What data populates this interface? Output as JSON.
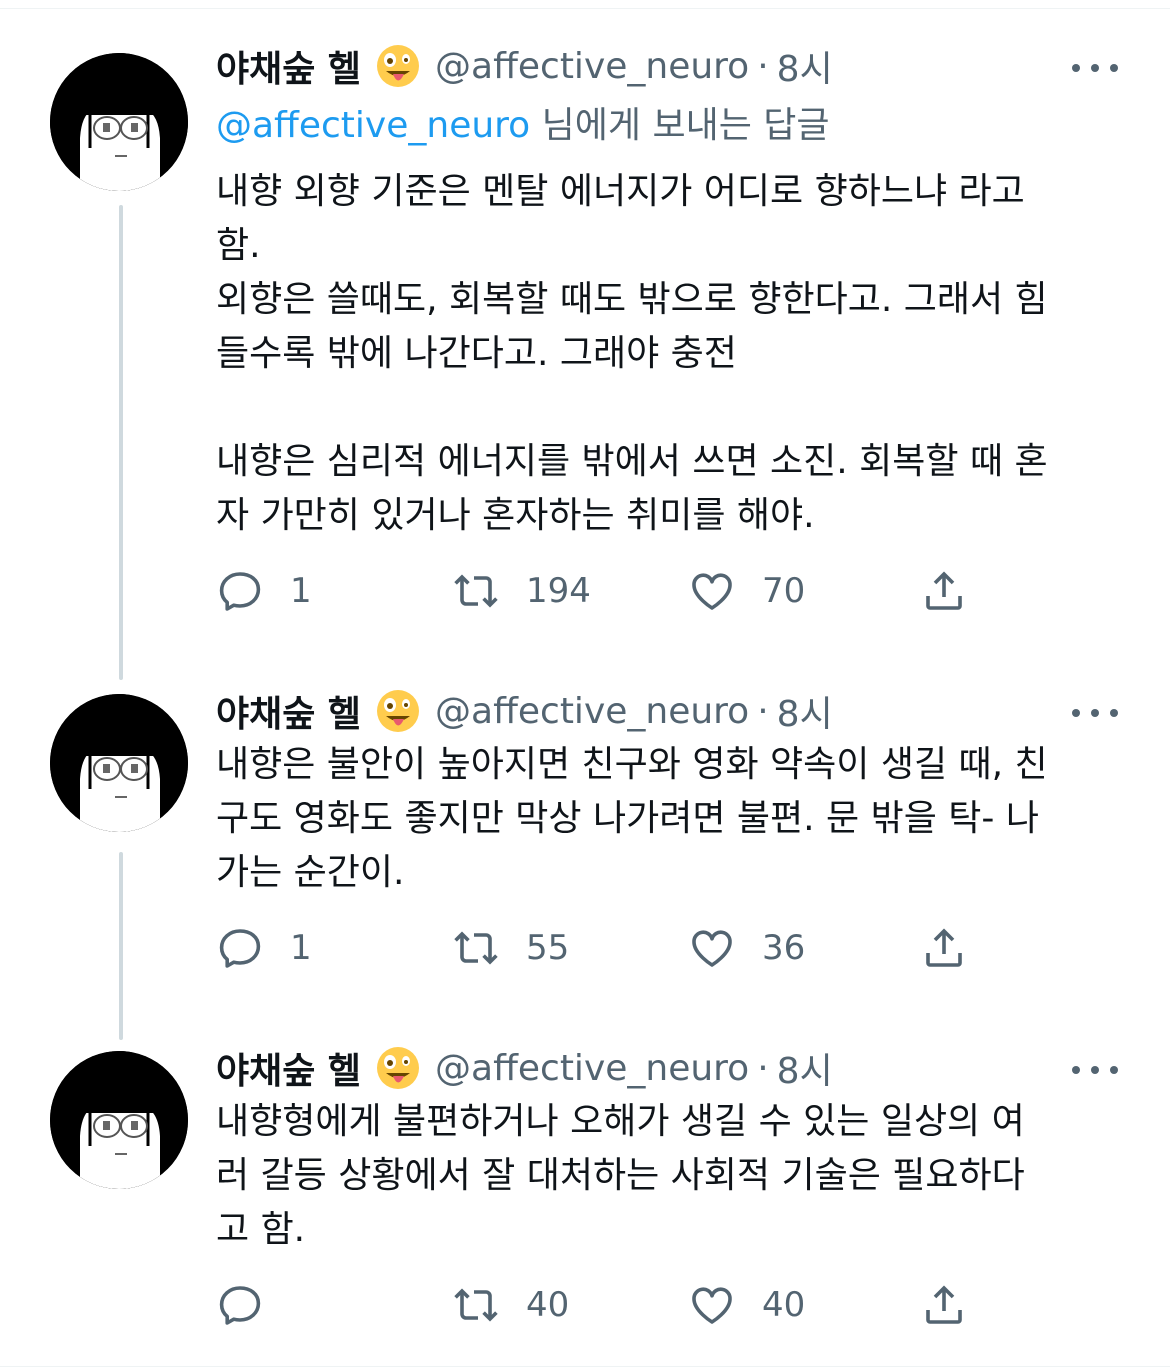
{
  "tweets": [
    {
      "name": "야채숲 헬",
      "handle": "@affective_neuro",
      "dot": "·",
      "time": "8시",
      "reply_to_handle": "@affective_neuro",
      "reply_to_suffix": " 님에게 보내는 답글",
      "text": "내향 외향 기준은 멘탈 에너지가 어디로 향하느냐 라고\n함.\n외향은 쓸때도, 회복할 때도 밖으로 향한다고. 그래서 힘\n들수록 밖에 나간다고. 그래야 충전\n\n내향은 심리적 에너지를 밖에서 쓰면 소진. 회복할 때 혼\n자 가만히 있거나 혼자하는 취미를 해야.",
      "replies": "1",
      "retweets": "194",
      "likes": "70"
    },
    {
      "name": "야채숲 헬",
      "handle": "@affective_neuro",
      "dot": "·",
      "time": "8시",
      "text": "내향은 불안이 높아지면 친구와 영화 약속이 생길 때, 친\n구도 영화도 좋지만 막상 나가려면 불편. 문 밖을 탁- 나\n가는 순간이.",
      "replies": "1",
      "retweets": "55",
      "likes": "36"
    },
    {
      "name": "야채숲 헬",
      "handle": "@affective_neuro",
      "dot": "·",
      "time": "8시",
      "text": "내향형에게 불편하거나 오해가 생길 수 있는 일상의 여\n러 갈등 상황에서 잘 대처하는 사회적 기술은 필요하다\n고 함.",
      "replies": "",
      "retweets": "40",
      "likes": "40"
    }
  ],
  "colors": {
    "text": "#0f1419",
    "secondary": "#536471",
    "link": "#1d9bf0",
    "thread_line": "#cfd9de",
    "emoji": "#ffcc4d"
  },
  "icons": [
    "avatar",
    "zany-face-emoji",
    "more-icon",
    "reply-icon",
    "retweet-icon",
    "like-icon",
    "share-icon"
  ]
}
